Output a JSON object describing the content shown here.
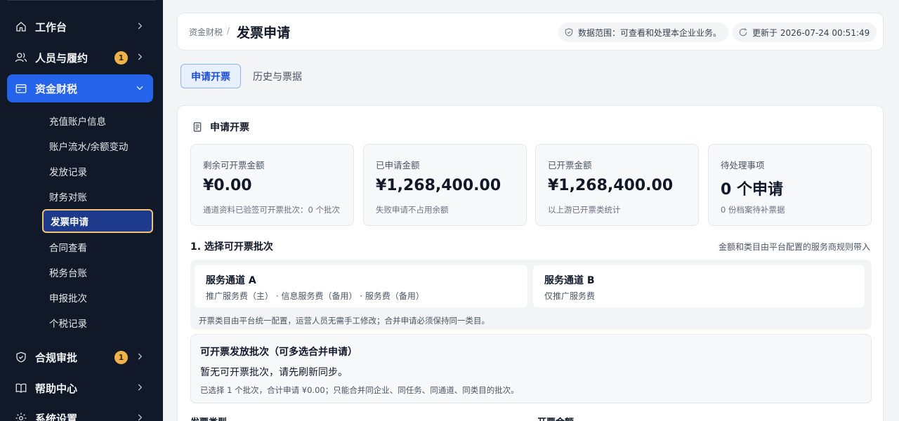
{
  "sidebar": {
    "items": [
      {
        "label": "工作台",
        "icon": "home-icon"
      },
      {
        "label": "人员与履约",
        "icon": "users-icon",
        "badge": "1"
      },
      {
        "label": "资金财税",
        "icon": "wallet-icon"
      },
      {
        "label": "合规审批",
        "icon": "shield-check-icon",
        "badge": "1"
      },
      {
        "label": "帮助中心",
        "icon": "book-icon"
      },
      {
        "label": "系统设置",
        "icon": "gear-icon"
      }
    ],
    "sub_items": [
      "充值账户信息",
      "账户流水/余额变动",
      "发放记录",
      "财务对账",
      "发票申请",
      "合同查看",
      "税务台账",
      "申报批次",
      "个税记录"
    ]
  },
  "header": {
    "breadcrumb": "资金财税",
    "separator": "/",
    "title": "发票申请",
    "scope": "数据范围：可查看和处理本企业业务。",
    "updated": "更新于 2026-07-24 00:51:49"
  },
  "tabs": [
    "申请开票",
    "历史与票据"
  ],
  "section": {
    "title": "申请开票"
  },
  "stats": [
    {
      "label": "剩余可开票金额",
      "value": "¥0.00",
      "note": "通道资料已验签可开票批次：0 个批次"
    },
    {
      "label": "已申请金额",
      "value": "¥1,268,400.00",
      "note": "失败申请不占用余额"
    },
    {
      "label": "已开票金额",
      "value": "¥1,268,400.00",
      "note": "以上游已开票类统计"
    },
    {
      "label": "待处理事项",
      "value": "0 个申请",
      "note": "0 份档案待补票据"
    }
  ],
  "step1": {
    "title": "1. 选择可开票批次",
    "hint": "金额和类目由平台配置的服务商规则带入",
    "channels": [
      {
        "title": "服务通道 A",
        "sub": "推广服务费（主） · 信息服务费（备用） · 服务费（备用）"
      },
      {
        "title": "服务通道 B",
        "sub": "仅推广服务费"
      }
    ],
    "channel_note": "开票类目由平台统一配置，运营人员无需手工修改；合并申请必须保持同一类目。"
  },
  "batch": {
    "title": "可开票发放批次（可多选合并申请）",
    "empty": "暂无可开票批次，请先刷新同步。",
    "note": "已选择 1 个批次，合计申请 ¥0.00；只能合并同企业、同任务、同通道、同类目的批次。"
  },
  "fields": [
    "发票类型",
    "开票金额"
  ],
  "colors": {
    "accent": "#2563eb",
    "sidebar_bg": "#111827",
    "badge": "#f0b34a",
    "active_border": "#f1c27a"
  }
}
